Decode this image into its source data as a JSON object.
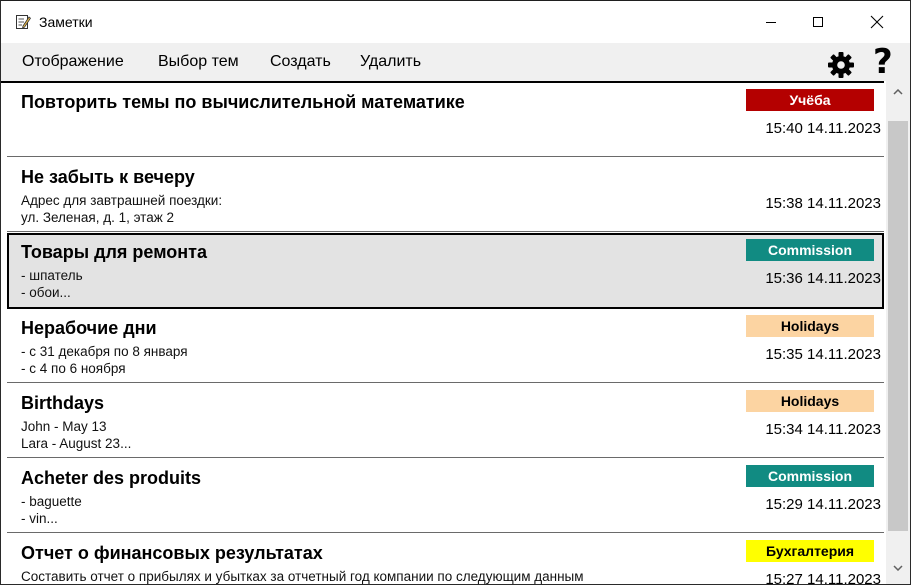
{
  "window": {
    "title": "Заметки",
    "icon": "notepad-pencil-icon"
  },
  "menu": {
    "items": [
      "Отображение",
      "Выбор тем",
      "Создать",
      "Удалить"
    ],
    "settings_icon": "gear-icon",
    "help_label": "?"
  },
  "notes": [
    {
      "title": "Повторить темы по вычислительной математике",
      "lines": [
        "",
        ""
      ],
      "date": "15:40 14.11.2023",
      "tag": {
        "label": "Учёба",
        "bg": "#b40000",
        "fg": "#ffffff"
      }
    },
    {
      "title": "Не забыть к вечеру",
      "lines": [
        "Адрес для завтрашней поездки:",
        "ул. Зеленая, д. 1, этаж 2"
      ],
      "date": "15:38 14.11.2023",
      "tag": null
    },
    {
      "title": "Товары для ремонта",
      "lines": [
        "- шпатель",
        "- обои..."
      ],
      "date": "15:36 14.11.2023",
      "tag": {
        "label": "Commission",
        "bg": "#118b82",
        "fg": "#ffffff"
      },
      "selected": true
    },
    {
      "title": "Нерабочие дни",
      "lines": [
        "- с 31 декабря по 8 января",
        "- с 4 по 6 ноября"
      ],
      "date": "15:35 14.11.2023",
      "tag": {
        "label": "Holidays",
        "bg": "#fcd4a2",
        "fg": "#000000"
      }
    },
    {
      "title": "Birthdays",
      "lines": [
        "John - May 13",
        "Lara - August 23..."
      ],
      "date": "15:34 14.11.2023",
      "tag": {
        "label": "Holidays",
        "bg": "#fcd4a2",
        "fg": "#000000"
      }
    },
    {
      "title": "Acheter des produits",
      "lines": [
        "- baguette",
        "- vin..."
      ],
      "date": "15:29 14.11.2023",
      "tag": {
        "label": "Commission",
        "bg": "#118b82",
        "fg": "#ffffff"
      }
    },
    {
      "title": "Отчет о финансовых результатах",
      "lines": [
        "Составить отчет о прибылях и убытках за отчетный год компании по следующим данным",
        ""
      ],
      "date": "15:27 14.11.2023",
      "tag": {
        "label": "Бухгалтерия",
        "bg": "#ffff00",
        "fg": "#000000"
      }
    }
  ]
}
